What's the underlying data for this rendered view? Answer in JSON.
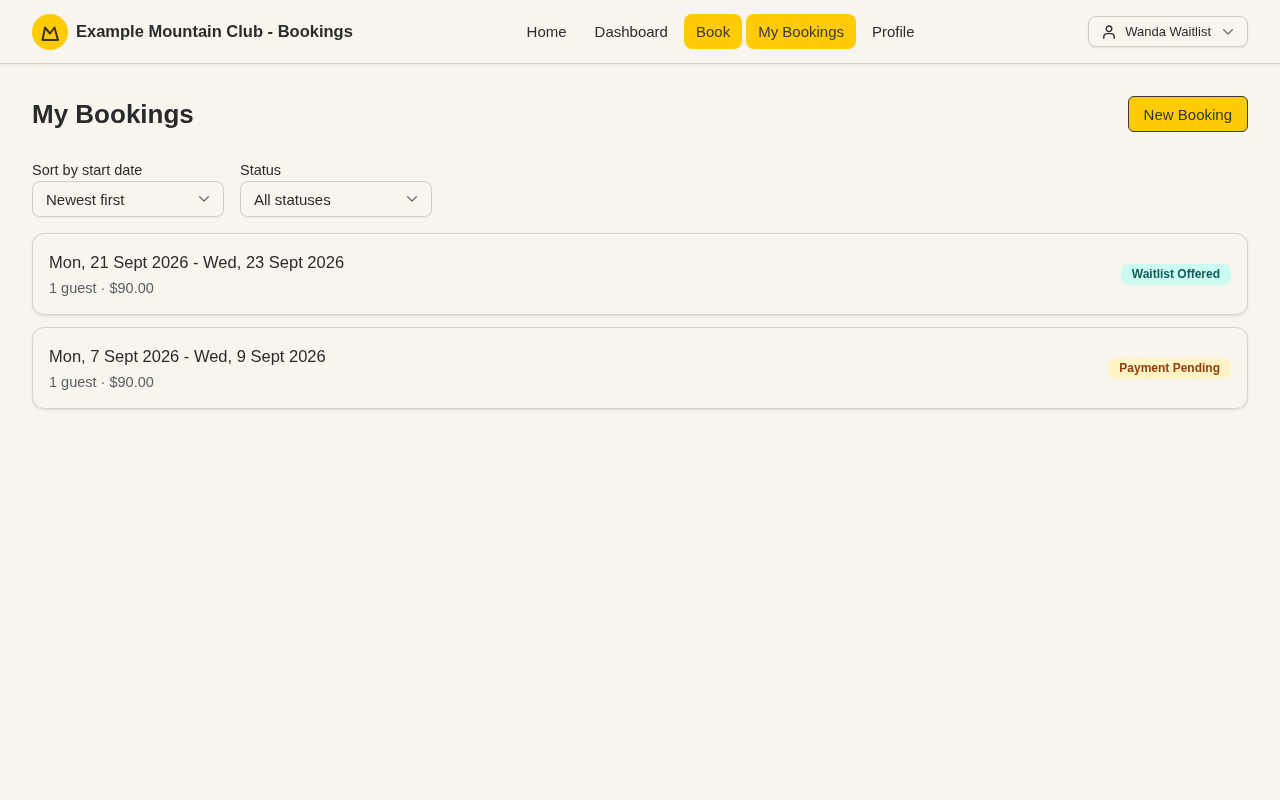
{
  "header": {
    "title": "Example Mountain Club - Bookings",
    "nav": [
      {
        "label": "Home",
        "selected": false
      },
      {
        "label": "Dashboard",
        "selected": false
      },
      {
        "label": "Book",
        "selected": true
      },
      {
        "label": "My Bookings",
        "selected": true
      },
      {
        "label": "Profile",
        "selected": false
      }
    ],
    "user_menu": {
      "label": "Wanda Waitlist"
    }
  },
  "page": {
    "title": "My Bookings",
    "new_button": "New Booking"
  },
  "filters": [
    {
      "label": "Sort by start date",
      "value": "Newest first"
    },
    {
      "label": "Status",
      "value": "All statuses"
    }
  ],
  "bookings": [
    {
      "dates": "Mon, 21 Sept 2026 - Wed, 23 Sept 2026",
      "details": "1 guest · $90.00",
      "status": {
        "label": "Waitlist Offered",
        "kind": "offered",
        "color": "#115e59"
      }
    },
    {
      "dates": "Mon, 7 Sept 2026 - Wed, 9 Sept 2026",
      "details": "1 guest · $90.00",
      "status": {
        "label": "Payment Pending",
        "kind": "pending",
        "color": "#92400e"
      }
    }
  ]
}
